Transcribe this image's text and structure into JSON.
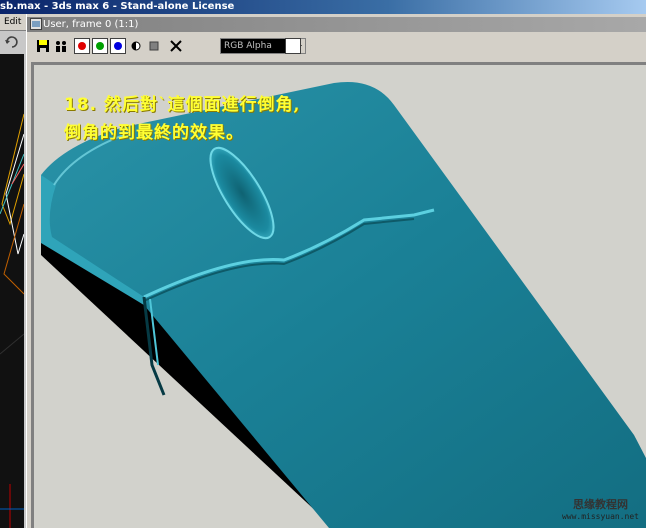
{
  "app": {
    "title": "sb.max - 3ds max 6 - Stand-alone License",
    "menu_edit": "Edit"
  },
  "render_window": {
    "title": "User, frame 0 (1:1)",
    "channel": {
      "selected": "RGB Alpha"
    },
    "toolbar_icons": [
      "save-icon",
      "clone-icon",
      "red-channel-icon",
      "green-channel-icon",
      "blue-channel-icon",
      "alpha-channel-icon",
      "monochrome-icon",
      "clear-icon"
    ],
    "channel_colors": {
      "red": "#e00000",
      "green": "#00a000",
      "blue": "#0000e0"
    },
    "background_color_swatch": "#ffffff"
  },
  "caption": {
    "line1_num": "18.",
    "line1_text": "然后對`這個面進行倒角,",
    "line2_text": "倒角的到最終的效果。",
    "color": "#ffff33"
  },
  "watermark": {
    "name": "思缘教程网",
    "url": "www.missyuan.net"
  },
  "model_colors": {
    "body": "#1a7e92",
    "highlight": "#3db3c9",
    "shadow": "#000000",
    "background": "#d2d2cc"
  }
}
